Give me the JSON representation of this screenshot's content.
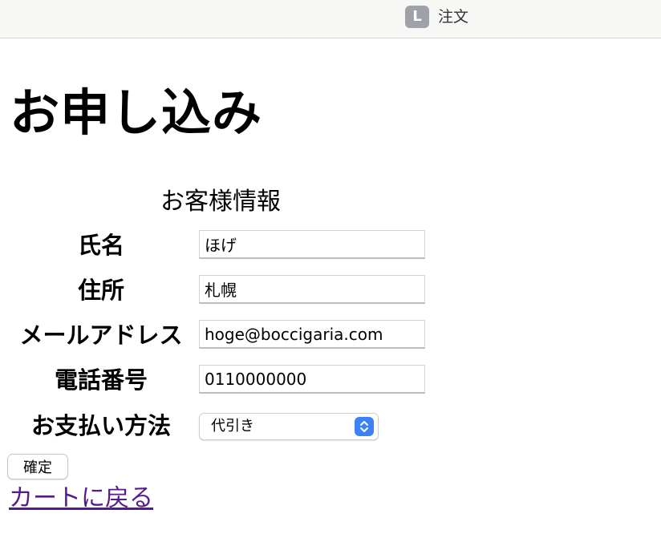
{
  "tab": {
    "favicon_letter": "L",
    "title": "注文"
  },
  "page": {
    "heading": "お申し込み",
    "caption": "お客様情報"
  },
  "form": {
    "name_label": "氏名",
    "name_value": "ほげ",
    "address_label": "住所",
    "address_value": "札幌",
    "email_label": "メールアドレス",
    "email_value": "hoge@boccigaria.com",
    "phone_label": "電話番号",
    "phone_value": "0110000000",
    "payment_label": "お支払い方法",
    "payment_value": "代引き",
    "confirm_label": "確定"
  },
  "back_link": "カートに戻る",
  "colors": {
    "select_accent": "#3b82f6",
    "visited_link": "#551a8b"
  }
}
